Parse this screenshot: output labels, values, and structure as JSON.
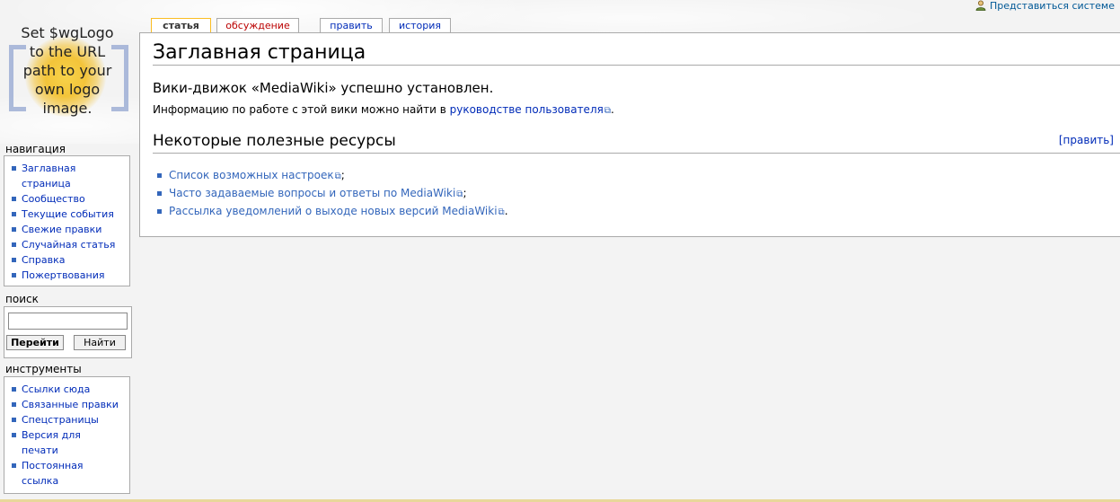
{
  "personal": {
    "login_label": "Представиться системе",
    "icon": "user-icon"
  },
  "logo": {
    "line1": "Set $wgLogo",
    "line2": "to the URL",
    "line3": "path to your",
    "line4": "own logo",
    "line5": "image."
  },
  "tabs": [
    {
      "label": "статья"
    },
    {
      "label": "обсуждение"
    },
    {
      "label": "править"
    },
    {
      "label": "история"
    }
  ],
  "content": {
    "heading": "Заглавная страница",
    "intro": "Вики-движок «MediaWiki» успешно установлен.",
    "info_prefix": "Информацию по работе с этой вики можно найти в ",
    "info_link": "руководстве пользователя",
    "info_suffix": ".",
    "section_title": "Некоторые полезные ресурсы",
    "section_edit": "[править]",
    "resources": [
      {
        "link": "Список возможных настроек",
        "suffix": ";"
      },
      {
        "link": "Часто задаваемые вопросы и ответы по MediaWiki",
        "suffix": ";"
      },
      {
        "link": "Рассылка уведомлений о выходе новых версий MediaWiki",
        "suffix": "."
      }
    ]
  },
  "sidebar": {
    "nav_title": "навигация",
    "nav_items": [
      {
        "label": "Заглавная страница"
      },
      {
        "label": "Сообщество"
      },
      {
        "label": "Текущие события"
      },
      {
        "label": "Свежие правки"
      },
      {
        "label": "Случайная статья"
      },
      {
        "label": "Справка"
      },
      {
        "label": "Пожертвования"
      }
    ],
    "search_title": "поиск",
    "search_value": "",
    "go_label": "Перейти",
    "search_label": "Найти",
    "tools_title": "инструменты",
    "tools_items": [
      {
        "label": "Ссылки сюда"
      },
      {
        "label": "Связанные правки"
      },
      {
        "label": "Спецстраницы"
      },
      {
        "label": "Версия для печати"
      },
      {
        "label": "Постоянная ссылка"
      }
    ]
  },
  "colors": {
    "link": "#002bb8",
    "ext_link": "#3366bb",
    "new_link": "#ba0000",
    "tab_selected_border": "#fabd23"
  }
}
